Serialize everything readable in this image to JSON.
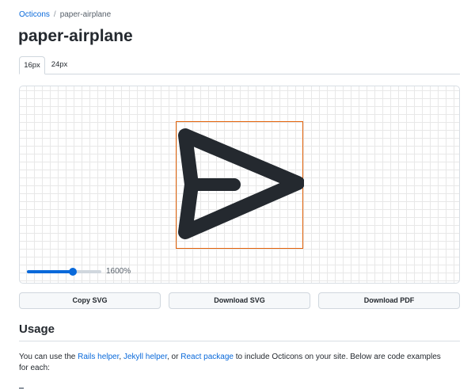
{
  "breadcrumb": {
    "root": "Octicons",
    "separator": "/",
    "current": "paper-airplane"
  },
  "page": {
    "title": "paper-airplane"
  },
  "tabs": [
    {
      "label": "16px",
      "active": true
    },
    {
      "label": "24px",
      "active": false
    }
  ],
  "preview": {
    "icon": "paper-airplane-icon",
    "icon_color": "#24292f",
    "bounding_box_color": "#e36209",
    "zoom": {
      "label": "1600%",
      "level": 0.62
    }
  },
  "actions": {
    "copy_svg": "Copy SVG",
    "download_svg": "Download SVG",
    "download_pdf": "Download PDF"
  },
  "usage": {
    "title": "Usage",
    "text_before": "You can use the ",
    "link_rails": "Rails helper",
    "sep_1": ", ",
    "link_jekyll": "Jekyll helper",
    "sep_2": ", or ",
    "link_react": "React package",
    "text_after": " to include Octicons on your site. Below are code examples for each:"
  },
  "colors": {
    "link": "#0969da",
    "accent": "#0969da",
    "text": "#24292f",
    "border": "#d0d7de"
  }
}
